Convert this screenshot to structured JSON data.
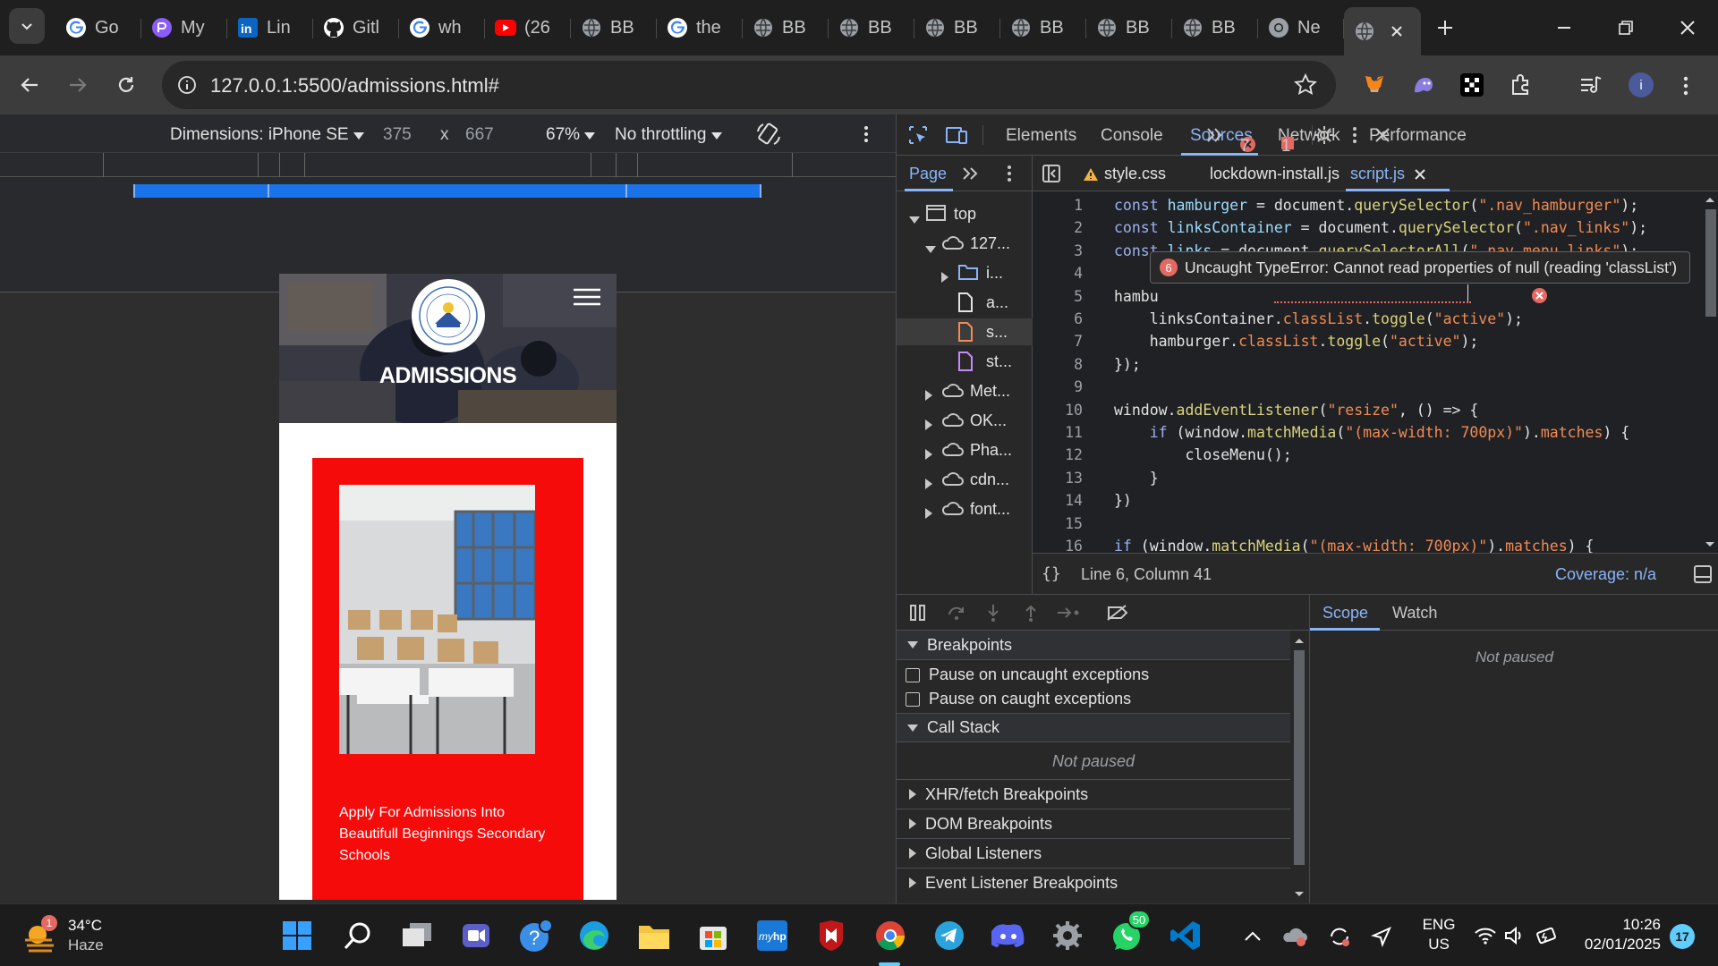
{
  "browser": {
    "tabs": [
      {
        "title": "Go",
        "icon": "google-icon"
      },
      {
        "title": "My",
        "icon": "proton-icon"
      },
      {
        "title": "Lin",
        "icon": "linkedin-icon"
      },
      {
        "title": "Gitl",
        "icon": "github-icon"
      },
      {
        "title": "wh",
        "icon": "google-icon"
      },
      {
        "title": "(26",
        "icon": "youtube-icon"
      },
      {
        "title": "BB",
        "icon": "globe-icon"
      },
      {
        "title": "the",
        "icon": "google-icon"
      },
      {
        "title": "BB",
        "icon": "globe-icon"
      },
      {
        "title": "BB",
        "icon": "globe-icon"
      },
      {
        "title": "BB",
        "icon": "globe-icon"
      },
      {
        "title": "BB",
        "icon": "globe-icon"
      },
      {
        "title": "BB",
        "icon": "globe-icon"
      },
      {
        "title": "BB",
        "icon": "globe-icon"
      },
      {
        "title": "Ne",
        "icon": "chrome-icon"
      }
    ],
    "url": "127.0.0.1:5500/admissions.html#"
  },
  "device_toolbar": {
    "dimensions": "Dimensions: iPhone SE",
    "width": "375",
    "times": "x",
    "height": "667",
    "zoom": "67%",
    "throttling": "No throttling"
  },
  "page": {
    "heading": "ADMISSIONS",
    "apply_text": "Apply For Admissions Into Beautifull Beginnings Secondary Schools",
    "colors": {
      "red": "#f60b0b"
    }
  },
  "devtools": {
    "tabs": [
      "Elements",
      "Console",
      "Sources",
      "Network",
      "Performance"
    ],
    "active_tab": "Sources",
    "errors": "7",
    "warnings": "1",
    "nav_tab": "Page",
    "tree": [
      {
        "label": "top",
        "icon": "frame-icon",
        "level": 0,
        "state": "open"
      },
      {
        "label": "127...",
        "icon": "cloud-icon",
        "level": 1,
        "state": "open"
      },
      {
        "label": "i...",
        "icon": "folder-icon",
        "level": 2,
        "state": "closed"
      },
      {
        "label": "a...",
        "icon": "file-icon",
        "level": 2,
        "state": "none"
      },
      {
        "label": "s...",
        "icon": "file-js-icon",
        "level": 2,
        "state": "none",
        "selected": true
      },
      {
        "label": "st...",
        "icon": "file-css-icon",
        "level": 2,
        "state": "none"
      },
      {
        "label": "Met...",
        "icon": "cloud-icon",
        "level": 1,
        "state": "closed"
      },
      {
        "label": "OK...",
        "icon": "cloud-icon",
        "level": 1,
        "state": "closed"
      },
      {
        "label": "Pha...",
        "icon": "cloud-icon",
        "level": 1,
        "state": "closed"
      },
      {
        "label": "cdn...",
        "icon": "cloud-icon",
        "level": 1,
        "state": "closed"
      },
      {
        "label": "font...",
        "icon": "cloud-icon",
        "level": 1,
        "state": "closed"
      }
    ],
    "file_tabs": [
      {
        "name": "style.css",
        "warning": true
      },
      {
        "name": "lockdown-install.js"
      },
      {
        "name": "script.js",
        "active": true
      }
    ],
    "code_lines": [
      {
        "n": "1",
        "html": "<span class=kw>const</span> <span class=vr>hamburger</span> = document.<span class=fn>querySelector</span>(<span class=st>\".nav_hamburger\"</span>);"
      },
      {
        "n": "2",
        "html": "<span class=kw>const</span> <span class=vr>linksContainer</span> = document.<span class=fn>querySelector</span>(<span class=st>\".nav_links\"</span>);"
      },
      {
        "n": "3",
        "html": "<span class=kw>const</span> <span class=vr>links</span> = document.<span class=fn>querySelectorAll</span>(<span class=st>\".nav_menu_links\"</span>);"
      },
      {
        "n": "4",
        "html": ""
      },
      {
        "n": "5",
        "html": "hambu"
      },
      {
        "n": "6",
        "html": "    linksContainer.<span class=pr>classList</span>.<span class=fn>toggle</span>(<span class=st>\"active\"</span>);"
      },
      {
        "n": "7",
        "html": "    hamburger.<span class=pr>classList</span>.<span class=fn>toggle</span>(<span class=st>\"active\"</span>);"
      },
      {
        "n": "8",
        "html": "});"
      },
      {
        "n": "9",
        "html": ""
      },
      {
        "n": "10",
        "html": "window.<span class=fn>addEventListener</span>(<span class=st>\"resize\"</span>, () => {"
      },
      {
        "n": "11",
        "html": "    <span class=kw>if</span> (window.<span class=fn>matchMedia</span>(<span class=st>\"(max-width: 700px)\"</span>).<span class=pr>matches</span>) {"
      },
      {
        "n": "12",
        "html": "        closeMenu();"
      },
      {
        "n": "13",
        "html": "    }"
      },
      {
        "n": "14",
        "html": "})"
      },
      {
        "n": "15",
        "html": ""
      },
      {
        "n": "16",
        "html": "<span class=kw>if</span> (window.<span class=fn>matchMedia</span>(<span class=st>\"(max-width: 700px)\"</span>).<span class=pr>matches</span>) {"
      }
    ],
    "error_count": "6",
    "error_message": "Uncaught TypeError: Cannot read properties of null (reading 'classList')",
    "position": "Line 6, Column 41",
    "coverage": "Coverage: n/a",
    "breakpoints": "Breakpoints",
    "pause_uncaught": "Pause on uncaught exceptions",
    "pause_caught": "Pause on caught exceptions",
    "call_stack": "Call Stack",
    "not_paused": "Not paused",
    "xhr": "XHR/fetch Breakpoints",
    "dom": "DOM Breakpoints",
    "global": "Global Listeners",
    "event": "Event Listener Breakpoints",
    "scope": "Scope",
    "watch": "Watch",
    "scope_not_paused": "Not paused"
  },
  "taskbar": {
    "temp": "34°C",
    "weather": "Haze",
    "weather_badge": "1",
    "whatsapp_badge": "50",
    "lang1": "ENG",
    "lang2": "US",
    "time": "10:26",
    "date": "02/01/2025",
    "notif": "17"
  }
}
